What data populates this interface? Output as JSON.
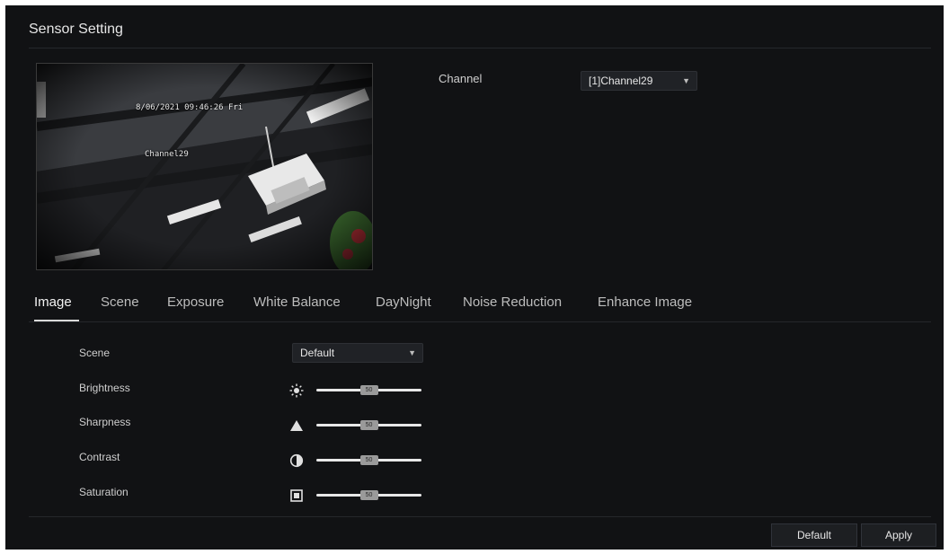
{
  "page": {
    "title": "Sensor Setting"
  },
  "preview": {
    "osd_datetime": "8/06/2021 09:46:26 Fri",
    "osd_channel": "Channel29"
  },
  "channel": {
    "label": "Channel",
    "value": "[1]Channel29"
  },
  "tabs": [
    {
      "label": "Image",
      "active": true
    },
    {
      "label": "Scene",
      "active": false
    },
    {
      "label": "Exposure",
      "active": false
    },
    {
      "label": "White Balance",
      "active": false
    },
    {
      "label": "DayNight",
      "active": false
    },
    {
      "label": "Noise Reduction",
      "active": false
    },
    {
      "label": "Enhance Image",
      "active": false
    }
  ],
  "image_settings": {
    "scene": {
      "label": "Scene",
      "value": "Default"
    },
    "brightness": {
      "label": "Brightness",
      "value": 50,
      "value_text": "50",
      "fraction": 0.5,
      "icon": "sun-icon"
    },
    "sharpness": {
      "label": "Sharpness",
      "value": 50,
      "value_text": "50",
      "fraction": 0.5,
      "icon": "triangle-icon"
    },
    "contrast": {
      "label": "Contrast",
      "value": 50,
      "value_text": "50",
      "fraction": 0.5,
      "icon": "contrast-icon"
    },
    "saturation": {
      "label": "Saturation",
      "value": 50,
      "value_text": "50",
      "fraction": 0.5,
      "icon": "saturation-icon"
    }
  },
  "buttons": {
    "default": "Default",
    "apply": "Apply"
  },
  "colors": {
    "panel_bg": "#111214",
    "control_bg": "#202226",
    "text": "#d9d9d9"
  }
}
